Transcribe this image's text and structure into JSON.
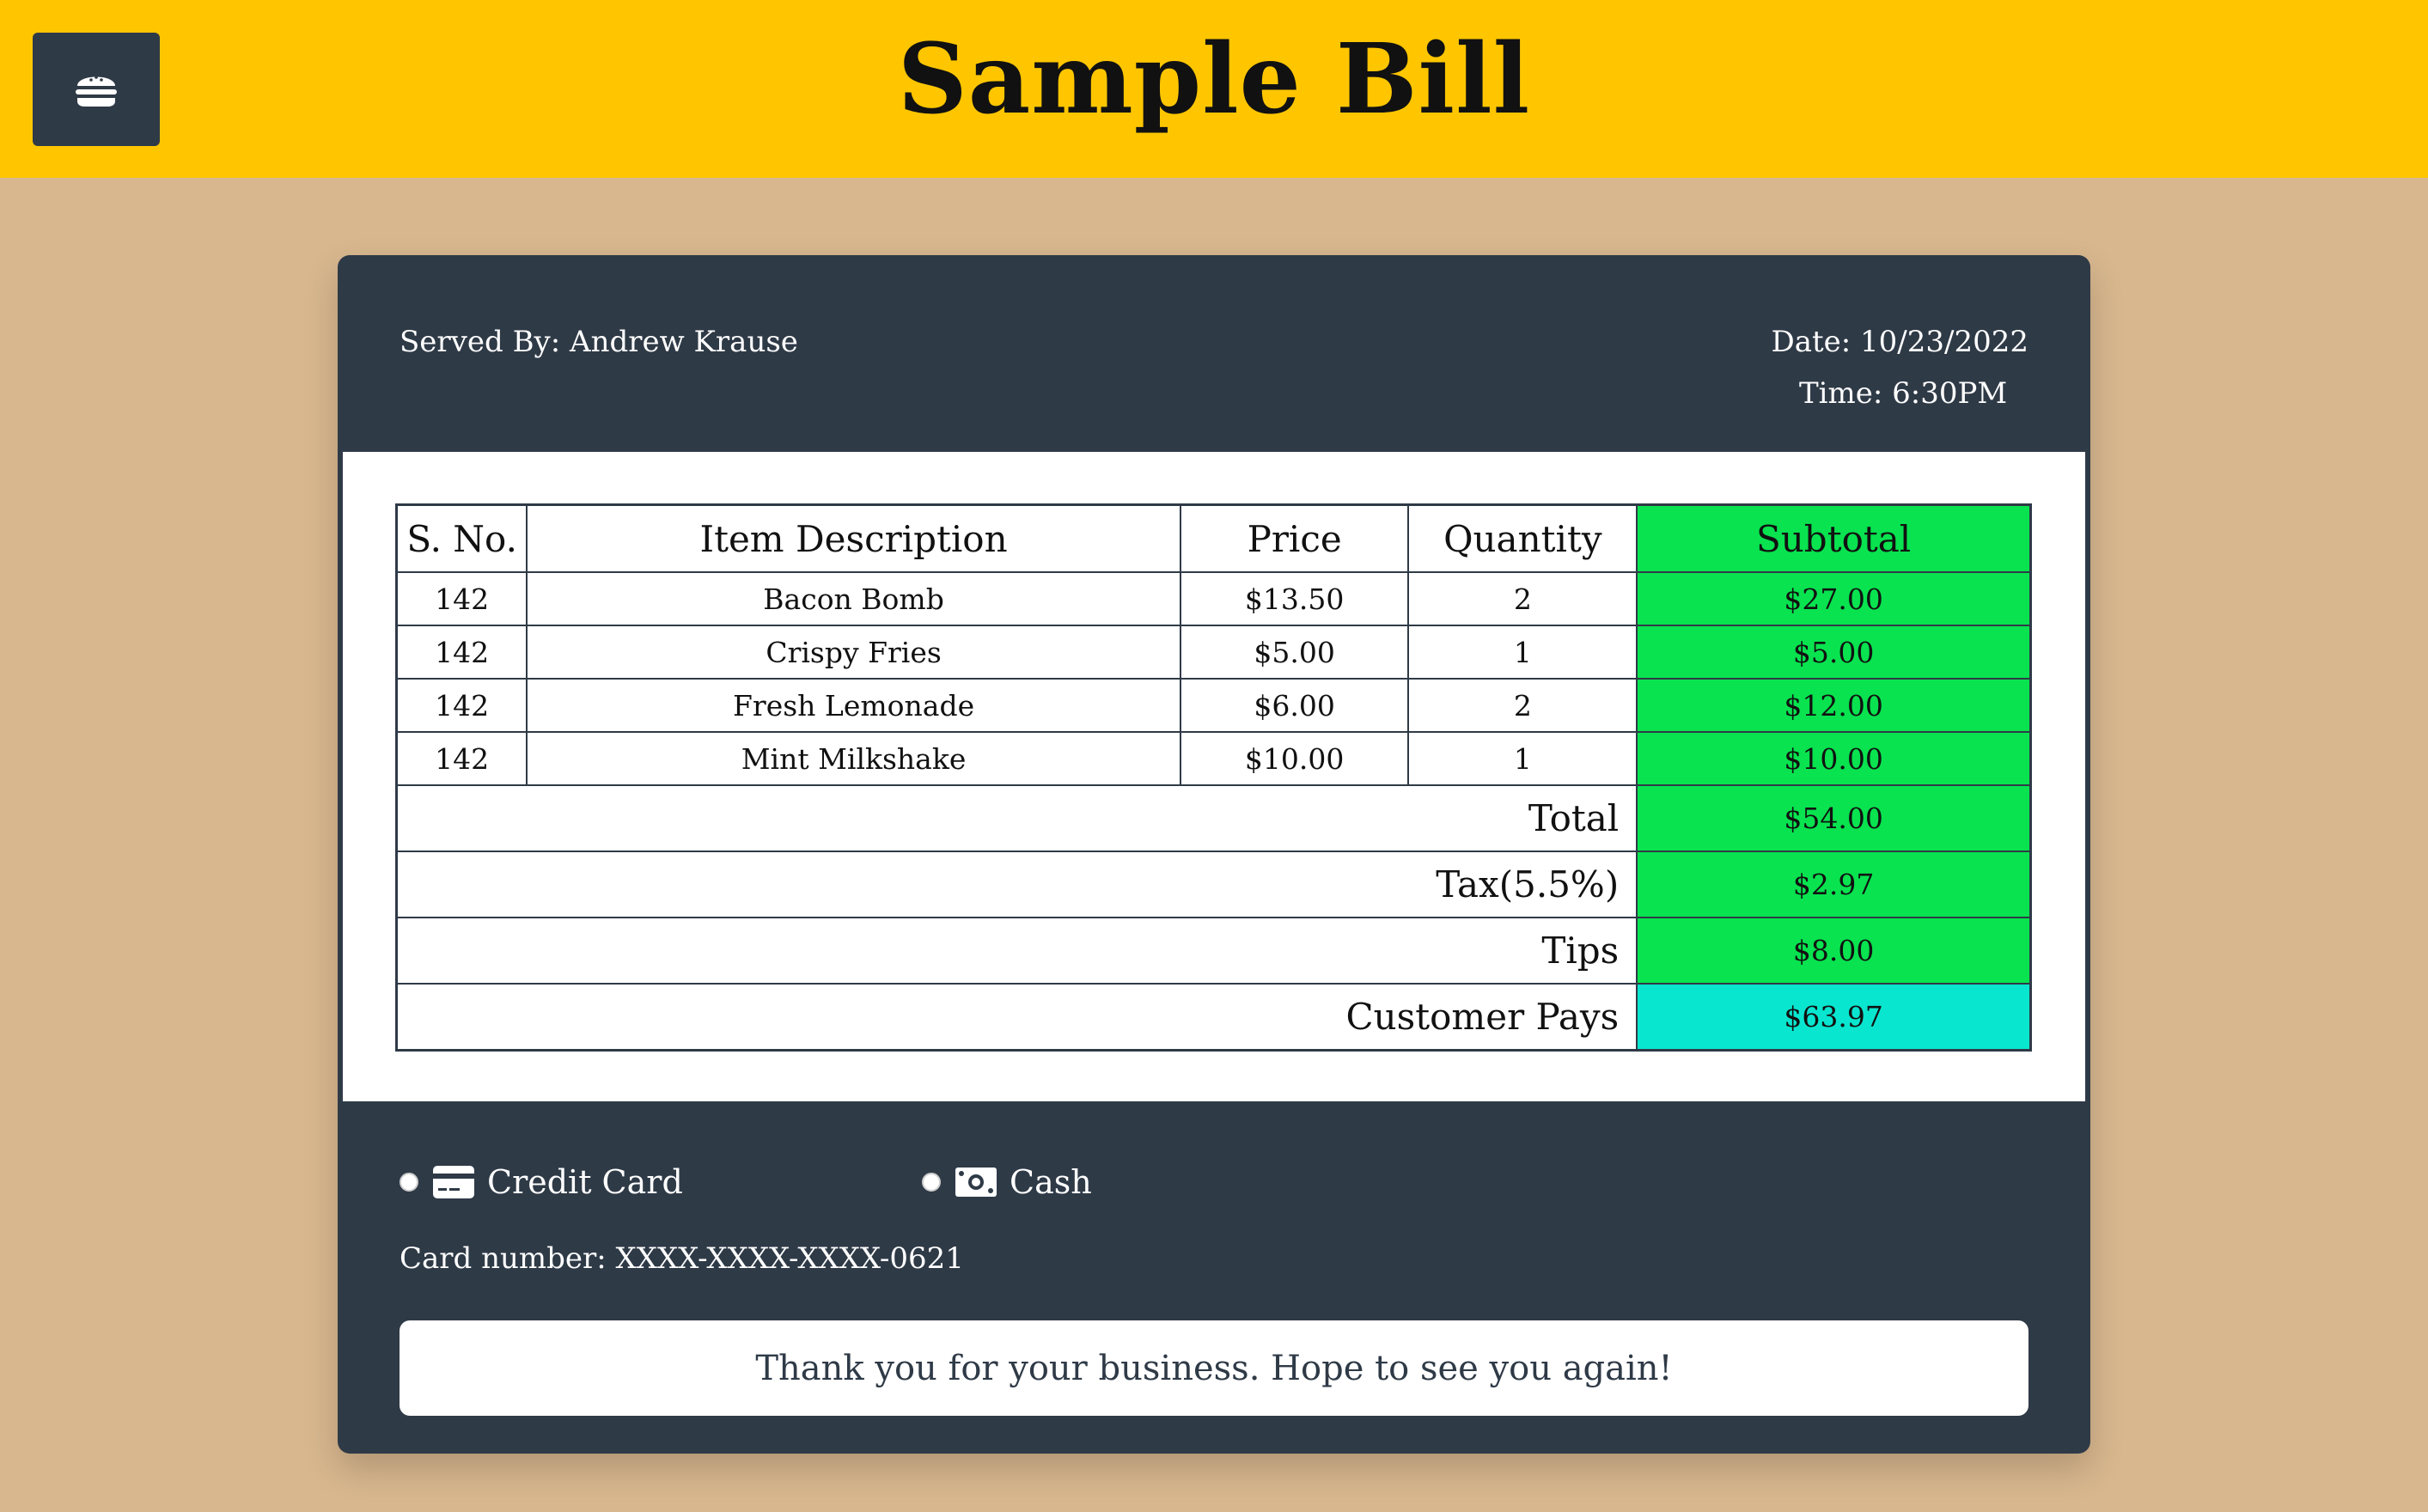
{
  "header": {
    "title": "Sample Bill",
    "menu_icon": "burger-icon",
    "background_color": "#ffc600"
  },
  "bill": {
    "served_by": "Served By: Andrew Krause",
    "date": "Date: 10/23/2022",
    "time": "Time: 6:30PM",
    "columns": [
      "S. No.",
      "Item Description",
      "Price",
      "Quantity",
      "Subtotal"
    ],
    "items": [
      {
        "sno": "142",
        "description": "Bacon Bomb",
        "price": "$13.50",
        "quantity": "2",
        "subtotal": "$27.00"
      },
      {
        "sno": "142",
        "description": "Crispy Fries",
        "price": "$5.00",
        "quantity": "1",
        "subtotal": "$5.00"
      },
      {
        "sno": "142",
        "description": "Fresh Lemonade",
        "price": "$6.00",
        "quantity": "2",
        "subtotal": "$12.00"
      },
      {
        "sno": "142",
        "description": "Mint Milkshake",
        "price": "$10.00",
        "quantity": "1",
        "subtotal": "$10.00"
      }
    ],
    "summary": [
      {
        "label": "Total",
        "value": "$54.00"
      },
      {
        "label": "Tax(5.5%)",
        "value": "$2.97"
      },
      {
        "label": "Tips",
        "value": "$8.00"
      },
      {
        "label": "Customer Pays",
        "value": "$63.97"
      }
    ]
  },
  "payment": {
    "credit_card_label": "Credit Card",
    "credit_card_icon": "credit-card-icon",
    "cash_label": "Cash",
    "cash_icon": "cash-icon",
    "card_number": "Card number: XXXX-XXXX-XXXX-0621"
  },
  "footer": {
    "thanks": "Thank you for your business. Hope to see you again!"
  },
  "colors": {
    "page_background": "#d8b78e",
    "card_background": "#2f3a47",
    "subtotal_green": "#08e34f",
    "customer_pays_cyan": "#09e6cf"
  }
}
